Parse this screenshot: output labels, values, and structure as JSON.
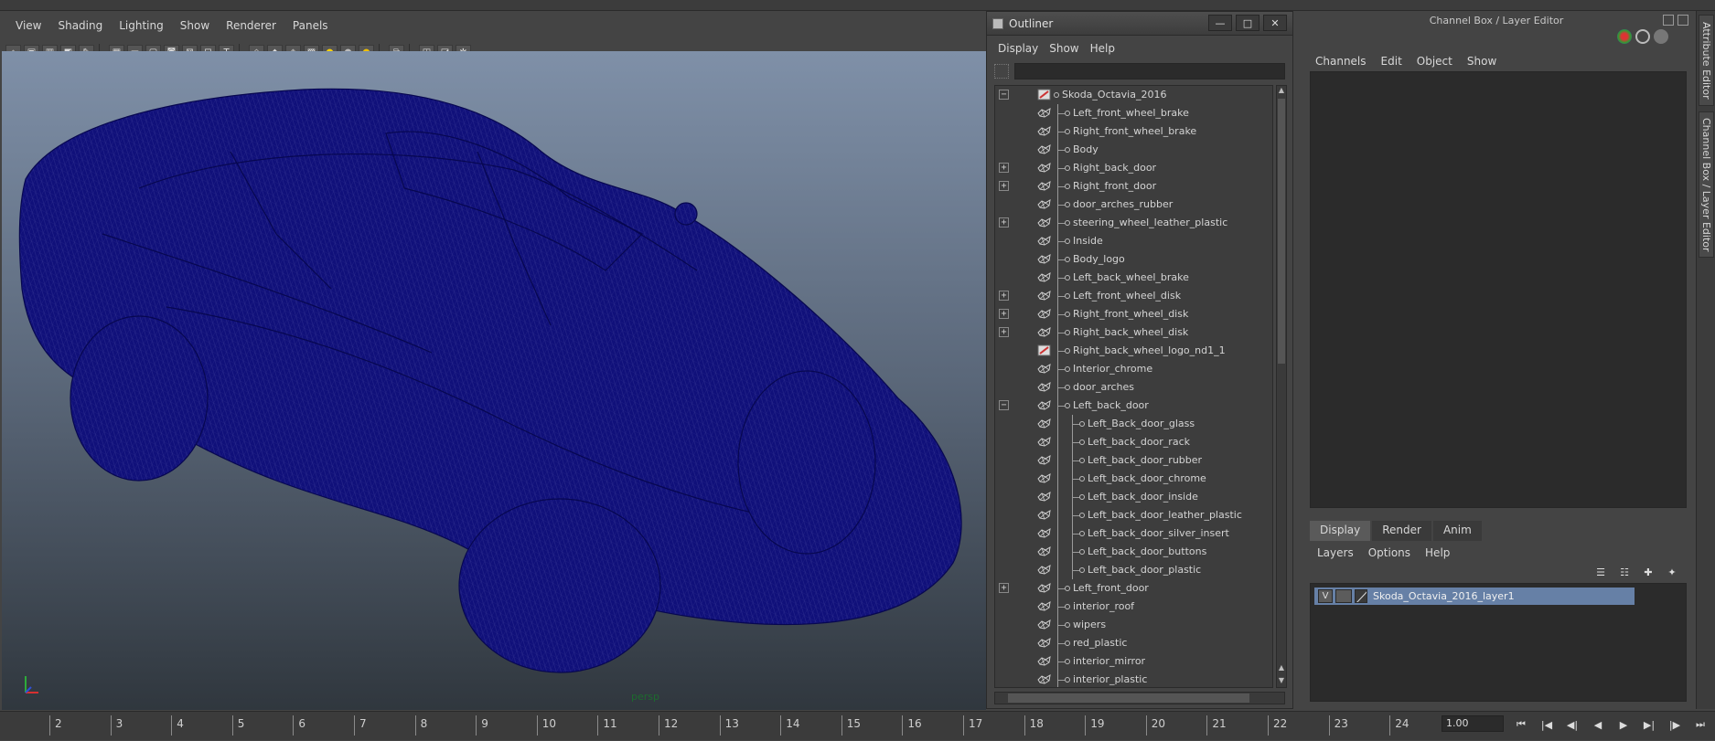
{
  "viewport": {
    "menus": [
      "View",
      "Shading",
      "Lighting",
      "Show",
      "Renderer",
      "Panels"
    ],
    "camera_label": "persp",
    "mesh_color": "#10107a",
    "axis": {
      "y": "y",
      "x": "x"
    }
  },
  "outliner": {
    "title": "Outliner",
    "window_buttons": {
      "minimize": "—",
      "maximize": "□",
      "close": "✕"
    },
    "menus": [
      "Display",
      "Show",
      "Help"
    ],
    "search_value": "",
    "items": [
      {
        "label": "Skoda_Octavia_2016",
        "depth": 0,
        "expander": "−",
        "icon": "group"
      },
      {
        "label": "Left_front_wheel_brake",
        "depth": 1,
        "expander": "",
        "icon": "mesh"
      },
      {
        "label": "Right_front_wheel_brake",
        "depth": 1,
        "expander": "",
        "icon": "mesh"
      },
      {
        "label": "Body",
        "depth": 1,
        "expander": "",
        "icon": "mesh"
      },
      {
        "label": "Right_back_door",
        "depth": 1,
        "expander": "+",
        "icon": "mesh"
      },
      {
        "label": "Right_front_door",
        "depth": 1,
        "expander": "+",
        "icon": "mesh"
      },
      {
        "label": "door_arches_rubber",
        "depth": 1,
        "expander": "",
        "icon": "mesh"
      },
      {
        "label": "steering_wheel_leather_plastic",
        "depth": 1,
        "expander": "+",
        "icon": "mesh"
      },
      {
        "label": "Inside",
        "depth": 1,
        "expander": "",
        "icon": "mesh"
      },
      {
        "label": "Body_logo",
        "depth": 1,
        "expander": "",
        "icon": "mesh"
      },
      {
        "label": "Left_back_wheel_brake",
        "depth": 1,
        "expander": "",
        "icon": "mesh"
      },
      {
        "label": "Left_front_wheel_disk",
        "depth": 1,
        "expander": "+",
        "icon": "mesh"
      },
      {
        "label": "Right_front_wheel_disk",
        "depth": 1,
        "expander": "+",
        "icon": "mesh"
      },
      {
        "label": "Right_back_wheel_disk",
        "depth": 1,
        "expander": "+",
        "icon": "mesh"
      },
      {
        "label": "Right_back_wheel_logo_nd1_1",
        "depth": 1,
        "expander": "",
        "icon": "group"
      },
      {
        "label": "Interior_chrome",
        "depth": 1,
        "expander": "",
        "icon": "mesh"
      },
      {
        "label": "door_arches",
        "depth": 1,
        "expander": "",
        "icon": "mesh"
      },
      {
        "label": "Left_back_door",
        "depth": 1,
        "expander": "−",
        "icon": "mesh"
      },
      {
        "label": "Left_Back_door_glass",
        "depth": 2,
        "expander": "",
        "icon": "mesh"
      },
      {
        "label": "Left_back_door_rack",
        "depth": 2,
        "expander": "",
        "icon": "mesh"
      },
      {
        "label": "Left_back_door_rubber",
        "depth": 2,
        "expander": "",
        "icon": "mesh"
      },
      {
        "label": "Left_back_door_chrome",
        "depth": 2,
        "expander": "",
        "icon": "mesh"
      },
      {
        "label": "Left_back_door_inside",
        "depth": 2,
        "expander": "",
        "icon": "mesh"
      },
      {
        "label": "Left_back_door_leather_plastic",
        "depth": 2,
        "expander": "",
        "icon": "mesh"
      },
      {
        "label": "Left_back_door_silver_insert",
        "depth": 2,
        "expander": "",
        "icon": "mesh"
      },
      {
        "label": "Left_back_door_buttons",
        "depth": 2,
        "expander": "",
        "icon": "mesh"
      },
      {
        "label": "Left_back_door_plastic",
        "depth": 2,
        "expander": "",
        "icon": "mesh"
      },
      {
        "label": "Left_front_door",
        "depth": 1,
        "expander": "+",
        "icon": "mesh"
      },
      {
        "label": "interior_roof",
        "depth": 1,
        "expander": "",
        "icon": "mesh"
      },
      {
        "label": "wipers",
        "depth": 1,
        "expander": "",
        "icon": "mesh"
      },
      {
        "label": "red_plastic",
        "depth": 1,
        "expander": "",
        "icon": "mesh"
      },
      {
        "label": "interior_mirror",
        "depth": 1,
        "expander": "",
        "icon": "mesh"
      },
      {
        "label": "interior_plastic",
        "depth": 1,
        "expander": "",
        "icon": "mesh"
      }
    ]
  },
  "channel_box": {
    "title": "Channel Box / Layer Editor",
    "menus": [
      "Channels",
      "Edit",
      "Object",
      "Show"
    ],
    "tabs": [
      "Display",
      "Render",
      "Anim"
    ],
    "active_tab": "Display",
    "layer_menus": [
      "Layers",
      "Options",
      "Help"
    ],
    "layer": {
      "visibility": "V",
      "name": "Skoda_Octavia_2016_layer1",
      "highlight": "#6680a6"
    }
  },
  "side_tabs": [
    "Attribute Editor",
    "Channel Box / Layer Editor"
  ],
  "timeline": {
    "frames": [
      "2",
      "3",
      "4",
      "5",
      "6",
      "7",
      "8",
      "9",
      "10",
      "11",
      "12",
      "13",
      "14",
      "15",
      "16",
      "17",
      "18",
      "19",
      "20",
      "21",
      "22",
      "23",
      "24"
    ],
    "current_frame": "1.00",
    "playback_buttons": [
      "⏮",
      "|◀",
      "◀|",
      "◀",
      "▶",
      "▶|",
      "|▶",
      "⏭"
    ]
  }
}
